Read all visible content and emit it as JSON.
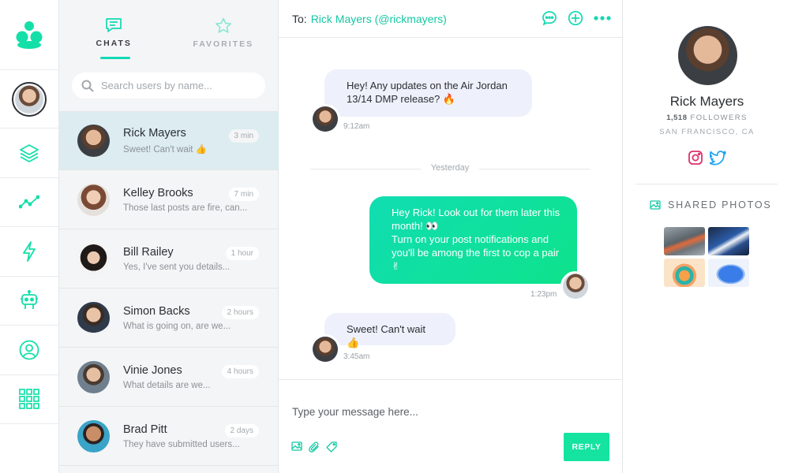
{
  "colors": {
    "accent": "#12d9b5",
    "accent_text": "#12c9a3",
    "bubble_in": "#eef0fb",
    "bubble_out_start": "#11ddb2",
    "bubble_out_end": "#0ee38b",
    "selected_row": "#dcecf0",
    "list_bg": "#f4f5f6",
    "instagram": "#e1306c",
    "twitter": "#1da1f2"
  },
  "rail": {
    "icons": [
      "app-logo",
      "user-avatar",
      "layers-icon",
      "trending-icon",
      "lightning-icon",
      "robot-icon",
      "profile-circle-icon",
      "apps-grid-icon"
    ]
  },
  "tabs": [
    {
      "label": "CHATS",
      "icon": "chat-bubble-icon",
      "active": true
    },
    {
      "label": "FAVORITES",
      "icon": "star-icon",
      "active": false
    }
  ],
  "search": {
    "placeholder": "Search users by name..."
  },
  "chats": [
    {
      "name": "Rick Mayers",
      "preview": "Sweet! Can't wait 👍",
      "time": "3 min",
      "active": true
    },
    {
      "name": "Kelley Brooks",
      "preview": "Those last posts are fire, can...",
      "time": "7 min",
      "active": false
    },
    {
      "name": "Bill Railey",
      "preview": "Yes, I've sent you details...",
      "time": "1 hour",
      "active": false
    },
    {
      "name": "Simon Backs",
      "preview": "What is going on, are we...",
      "time": "2 hours",
      "active": false
    },
    {
      "name": "Vinie Jones",
      "preview": "What details are we...",
      "time": "4 hours",
      "active": false
    },
    {
      "name": "Brad Pitt",
      "preview": "They have submitted users...",
      "time": "2 days",
      "active": false
    }
  ],
  "conversation": {
    "to_label": "To:",
    "recipient": "Rick Mayers (@rickmayers)",
    "actions": [
      "chat-icon",
      "add-icon",
      "more-icon"
    ],
    "messages": [
      {
        "direction": "in",
        "lines": [
          "Hey! Any updates on the Air Jordan",
          "13/14 DMP release? 🔥"
        ],
        "time": "9:12am"
      },
      {
        "direction": "out",
        "lines": [
          "Hey Rick! Look out for them later this",
          "month! 👀",
          "Turn on your post notifications and",
          "you'll be among the first to cop a pair",
          "✌"
        ],
        "time": "1:23pm"
      },
      {
        "direction": "in",
        "lines": [
          "Sweet! Can't wait 👍"
        ],
        "time": "3:45am"
      }
    ],
    "divider": "Yesterday",
    "composer": {
      "placeholder": "Type your message here...",
      "reply_label": "REPLY",
      "tools": [
        "image-icon",
        "paperclip-icon",
        "tag-icon"
      ]
    }
  },
  "profile": {
    "name": "Rick Mayers",
    "followers_count": "1,518",
    "followers_label": "FOLLOWERS",
    "location": "SAN FRANCISCO, CA",
    "social": [
      "instagram-icon",
      "twitter-icon"
    ],
    "shared_label": "SHARED PHOTOS",
    "photos": [
      "sneaker-photo-1",
      "sneaker-photo-2",
      "sunset-illustration",
      "blue-sneaker-art"
    ]
  }
}
